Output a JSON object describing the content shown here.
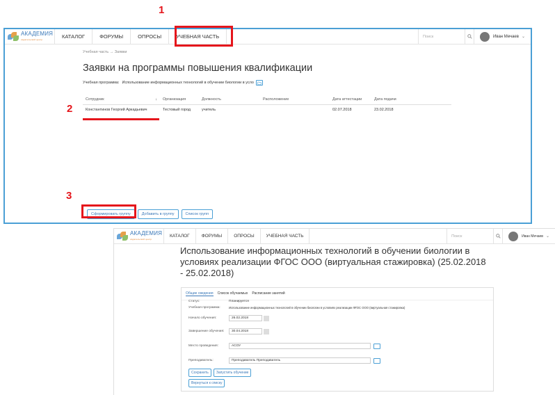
{
  "annotations": [
    "1",
    "2",
    "3"
  ],
  "screen1": {
    "logo": {
      "text": "АКАДЕМИЯ",
      "sub": "издательский центр"
    },
    "nav": [
      "КАТАЛОГ",
      "ФОРУМЫ",
      "ОПРОСЫ",
      "УЧЕБНАЯ ЧАСТЬ"
    ],
    "search_placeholder": "Поиск",
    "user_name": "Иван Мечаев",
    "breadcrumb": "Учебная часть → Заявки",
    "title": "Заявки на программы повышения квалификации",
    "program_label": "Учебная программа:",
    "program_value": "Использование информационных технологий в обучении биологии в усло",
    "table": {
      "headers": [
        "Сотрудник",
        "Организация",
        "Должность",
        "Расположение",
        "Дата аттестации",
        "Дата подачи"
      ],
      "sort_arrow": "↓",
      "rows": [
        [
          "Константинов Георгий Аркадьевич",
          "Тестовый город",
          "учитель",
          "",
          "02.07.2018",
          "23.02.2018"
        ]
      ]
    },
    "buttons": [
      "Сформировать группу",
      "Добавить в группу",
      "Список групп"
    ]
  },
  "screen2": {
    "logo": {
      "text": "АКАДЕМИЯ",
      "sub": "издательский центр"
    },
    "nav": [
      "КАТАЛОГ",
      "ФОРУМЫ",
      "ОПРОСЫ",
      "УЧЕБНАЯ ЧАСТЬ"
    ],
    "search_placeholder": "Поиск",
    "user_name": "Иван Мечаев",
    "title": "Использование информационных технологий в обучении биологии в условиях реализации ФГОС ООО (виртуальная стажировка) (25.02.2018 - 25.02.2018)",
    "tabs": [
      "Общие сведения",
      "Список обучаемых",
      "Расписание занятий"
    ],
    "fields": {
      "status_label": "Статус:",
      "status_value": "Планируется",
      "program_label": "Учебная программа:",
      "program_value": "Использование информационных технологий в обучении биологии в условиях реализации ФГОС ООО (виртуальная стажировка)",
      "start_label": "Начало обучения:",
      "start_value": "26.02.2018",
      "end_label": "Завершение обучения:",
      "end_value": "30.04.2018",
      "place_label": "Место проведения:",
      "place_value": "АСОУ",
      "teacher_label": "Преподаватель:",
      "teacher_value": "Преподаватель Преподаватель"
    },
    "buttons": {
      "save": "Сохранить",
      "launch": "Запустить обучение",
      "back": "Вернуться к списку"
    }
  },
  "colors": {
    "accent": "#3a78b8",
    "annotation": "#e5151b",
    "frame": "#4a9fd5"
  }
}
